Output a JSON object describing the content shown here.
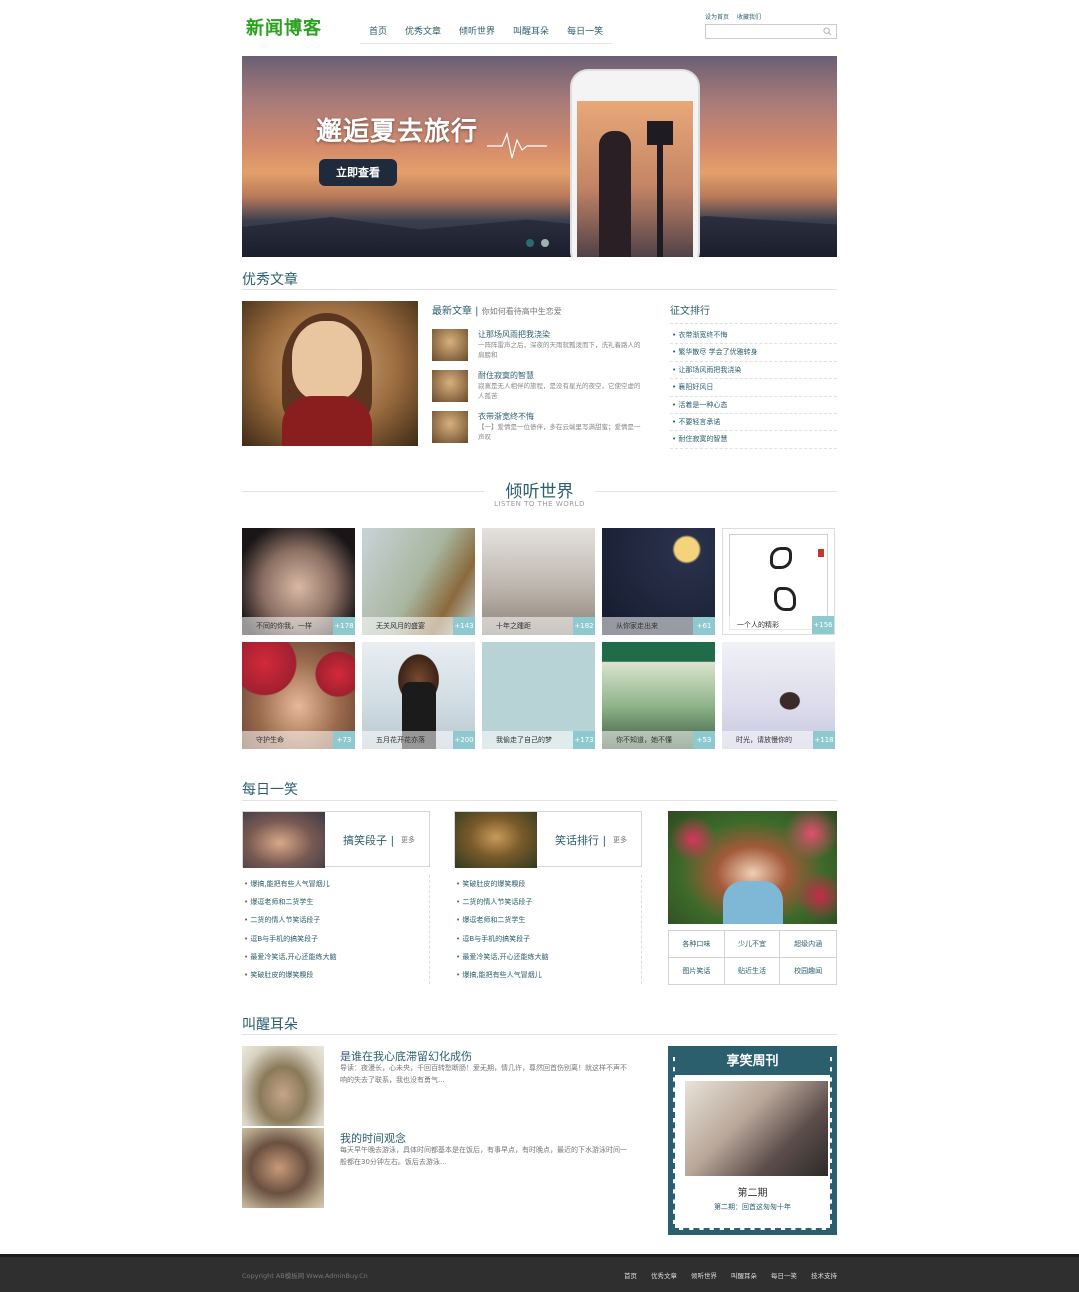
{
  "header": {
    "logo": "新闻博客",
    "nav": [
      "首页",
      "优秀文章",
      "倾听世界",
      "叫醒耳朵",
      "每日一笑"
    ],
    "top_links": [
      "设为首页",
      "收藏我们"
    ],
    "search_placeholder": ""
  },
  "banner": {
    "title": "邂逅夏去旅行",
    "cta": "立即查看",
    "slide_count": 2,
    "active_slide": 1
  },
  "articles": {
    "heading": "优秀文章",
    "new_head": "最新文章",
    "new_sub": "你如何看待高中生恋爱",
    "items": [
      {
        "title": "让那场风雨把我浇染",
        "desc": "一阵阵雷声之后，深夜的天雨就瓢泼而下，洗礼着路人的肩膀和"
      },
      {
        "title": "耐住寂寞的智慧",
        "desc": "寂寞是无人相伴的旅程，是没有星光的夜空，它使空虚的人孤苦"
      },
      {
        "title": "衣带渐宽终不悔",
        "desc": "【一】爱情是一位债伴，多在云端里写满甜蜜；爱情是一声叹"
      }
    ],
    "rank_head": "征文排行",
    "rank": [
      "衣带渐宽终不悔",
      "繁华散尽 学会了优雅转身",
      "让那场风雨把我浇染",
      "襄阳好风日",
      "活着是一种心态",
      "不要轻言承诺",
      "耐住寂寞的智慧"
    ]
  },
  "listen": {
    "title": "倾听世界",
    "subtitle": "LISTEN TO THE WORLD",
    "items": [
      {
        "cap": "不同的你我，一样",
        "count": "+178"
      },
      {
        "cap": "无关风月的盛宴",
        "count": "+143"
      },
      {
        "cap": "十年之踵距",
        "count": "+182"
      },
      {
        "cap": "从你家走出来",
        "count": "+61"
      },
      {
        "cap": "一个人的精彩",
        "count": "+156"
      },
      {
        "cap": "守护生命",
        "count": "+73"
      },
      {
        "cap": "五月花开花亦落",
        "count": "+200"
      },
      {
        "cap": "我偷走了自己的梦",
        "count": "+173"
      },
      {
        "cap": "你不知道，她不懂",
        "count": "+53"
      },
      {
        "cap": "时光，请放慢你的",
        "count": "+118"
      }
    ]
  },
  "joke": {
    "heading": "每日一笑",
    "box1": {
      "label": "搞笑段子 |",
      "more": "更多"
    },
    "box2": {
      "label": "笑话排行 |",
      "more": "更多"
    },
    "list1": [
      "爆搞,能把有些人气冒烟儿",
      "爆逗老师和二货学生",
      "二货的情人节笑话段子",
      "逗B与手机的搞笑段子",
      "最爱冷笑话,开心还能练大脑",
      "笑破肚皮的爆笑糗段"
    ],
    "list2": [
      "笑破肚皮的爆笑糗段",
      "二货的情人节笑话段子",
      "爆逗老师和二货学生",
      "逗B与手机的搞笑段子",
      "最爱冷笑话,开心还能练大脑",
      "爆搞,能把有些人气冒烟儿"
    ],
    "grid": [
      "各种口味",
      "少儿不宜",
      "超级内涵",
      "图片笑话",
      "贴近生活",
      "校园趣闻"
    ]
  },
  "wake": {
    "heading": "叫醒耳朵",
    "items": [
      {
        "title": "是谁在我心底滞留幻化成伤",
        "desc": "导读：夜漫长，心未央，千回百转愁断肠！爱无期，情几许，尊然回首伤别离！就这样不声不响的失去了联系，我也没有勇气..."
      },
      {
        "title": "我的时间观念",
        "desc": "每天早午晚去游泳，具体时间都基本是在饭后，有事早点，有时晚点，最近的下水游泳时间一般都在30分钟左右。饭后去游泳..."
      }
    ],
    "mag_head": "享笑周刊",
    "mag_title": "第二期",
    "mag_sub": "第二期：回首这匆匆十年"
  },
  "footer": {
    "copyright": "Copyright AB模板网 Www.AdminBuy.Cn",
    "links": [
      "首页",
      "优秀文章",
      "倾听世界",
      "叫醒耳朵",
      "每日一笑",
      "技术支持"
    ]
  },
  "colors": {
    "accent": "#2b5f6e",
    "logo": "#2aa11f",
    "footer": "#2f2f2f"
  }
}
